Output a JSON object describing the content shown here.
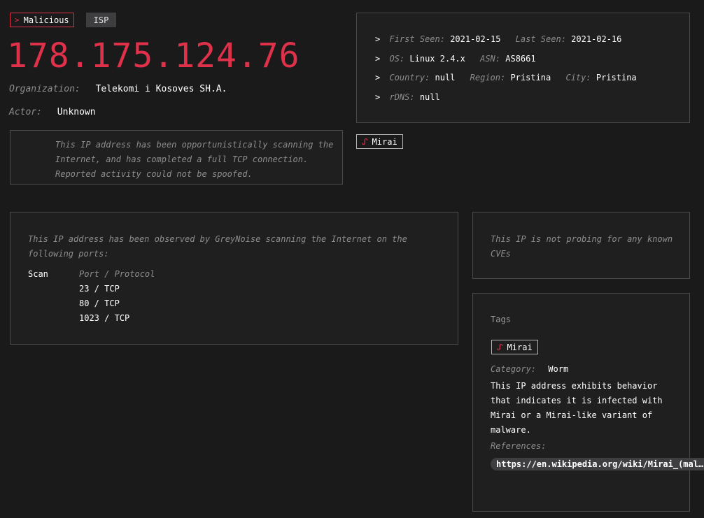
{
  "classification": {
    "label": "Malicious",
    "icon": "chevron-right-icon"
  },
  "isp_badge": "ISP",
  "ip": "178.175.124.76",
  "organization": {
    "label": "Organization:",
    "value": "Telekomi i Kosoves SH.A."
  },
  "actor": {
    "label": "Actor:",
    "value": "Unknown"
  },
  "description": "This IP address has been opportunistically scanning the Internet, and has completed a full TCP connection. Reported activity could not be spoofed.",
  "meta": {
    "first_seen_label": "First Seen:",
    "first_seen": "2021-02-15",
    "last_seen_label": "Last Seen:",
    "last_seen": "2021-02-16",
    "os_label": "OS:",
    "os": "Linux 2.4.x",
    "asn_label": "ASN:",
    "asn": "AS8661",
    "country_label": "Country:",
    "country": "null",
    "region_label": "Region:",
    "region": "Pristina",
    "city_label": "City:",
    "city": "Pristina",
    "rdns_label": "rDNS:",
    "rdns": "null"
  },
  "top_tag": {
    "label": "Mirai",
    "icon": "worm-icon"
  },
  "scan": {
    "intro": "This IP address has been observed by GreyNoise scanning the Internet on the following ports:",
    "label": "Scan",
    "header": "Port / Protocol",
    "ports": [
      "23 / TCP",
      "80 / TCP",
      "1023 / TCP"
    ]
  },
  "cve_text": "This IP is not probing for any known CVEs",
  "tags": {
    "title": "Tags",
    "tag": {
      "label": "Mirai",
      "icon": "worm-icon"
    },
    "category_label": "Category:",
    "category": "Worm",
    "body": "This IP address exhibits behavior that indicates it is infected with Mirai or a Mirai-like variant of malware.",
    "references_label": "References:",
    "reference": "https://en.wikipedia.org/wiki/Mirai_(mal…"
  },
  "colors": {
    "accent": "#e0314b",
    "background": "#1a1a1b",
    "border": "#4a4a4c"
  }
}
